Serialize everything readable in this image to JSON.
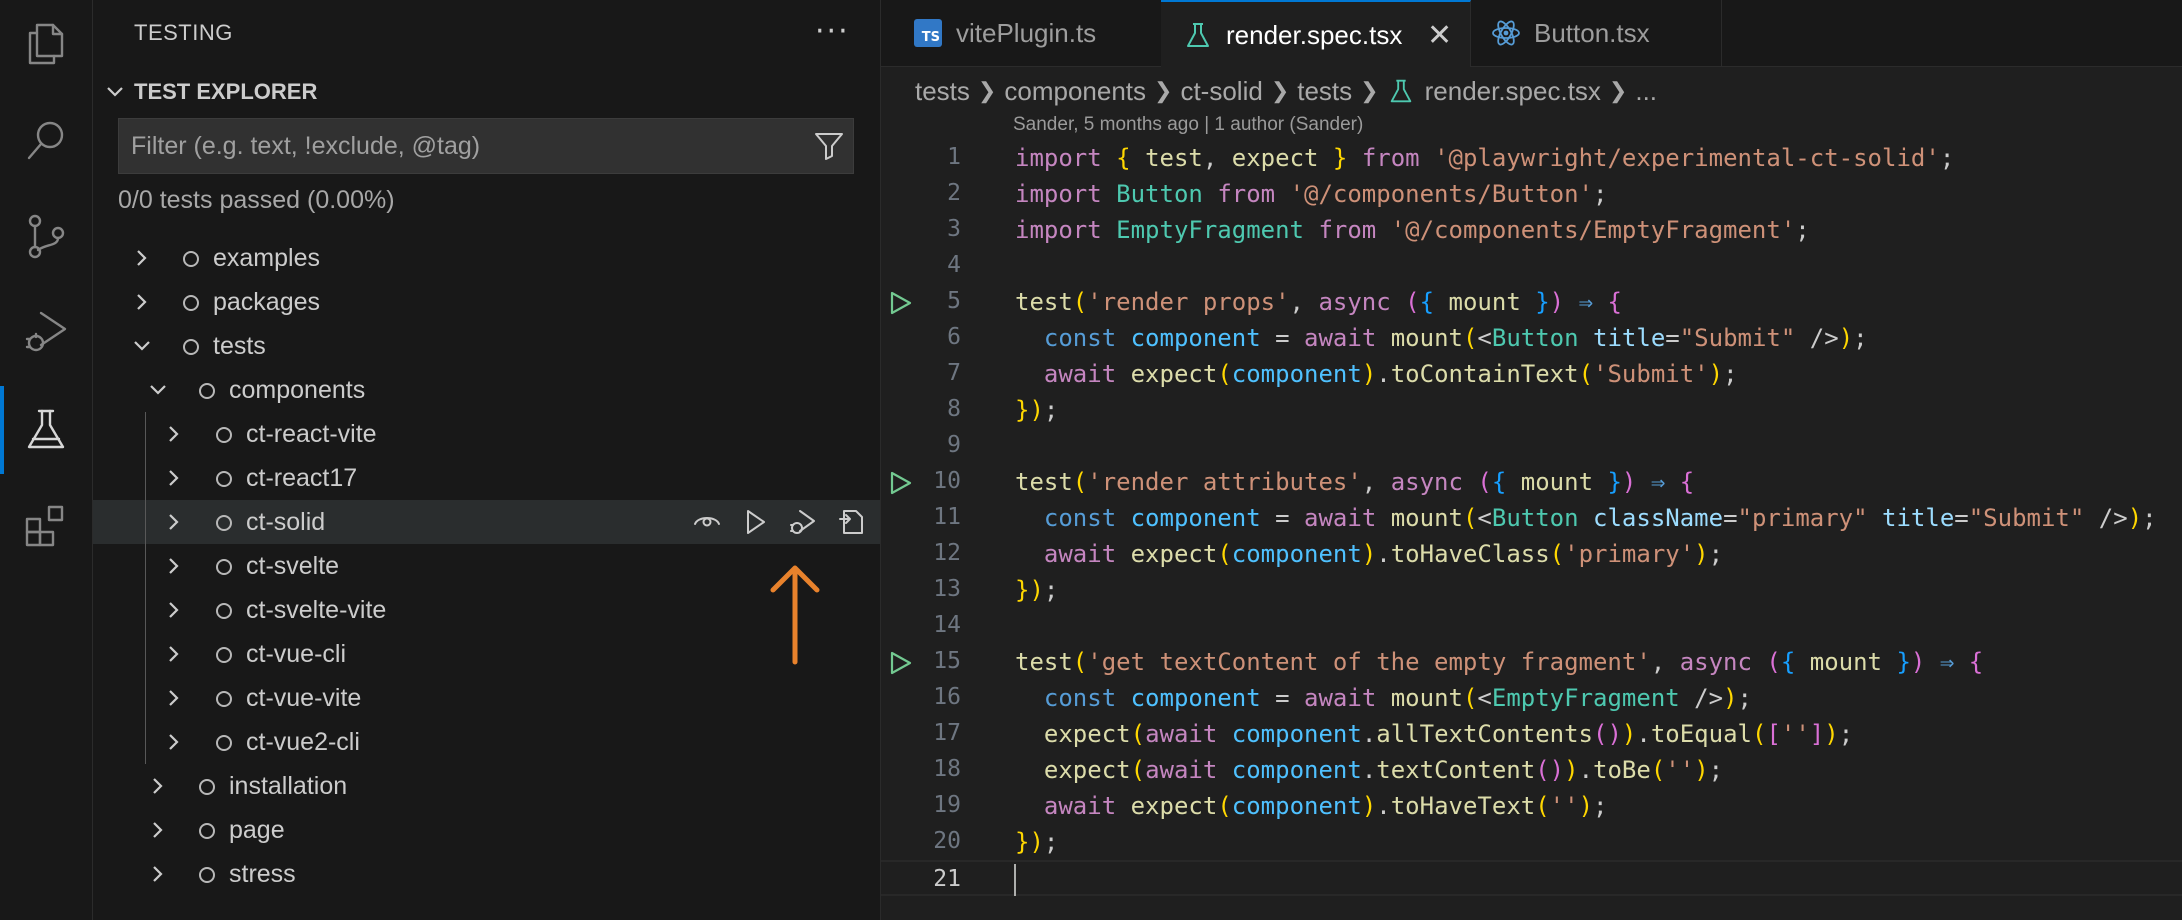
{
  "sidebar": {
    "title": "TESTING",
    "more": "···",
    "section_title": "TEST EXPLORER",
    "filter_placeholder": "Filter (e.g. text, !exclude, @tag)",
    "summary": "0/0 tests passed (0.00%)",
    "tree": [
      {
        "label": "examples",
        "expanded": false
      },
      {
        "label": "packages",
        "expanded": false
      },
      {
        "label": "tests",
        "expanded": true
      },
      {
        "label": "components",
        "expanded": true
      },
      {
        "label": "ct-react-vite",
        "expanded": false
      },
      {
        "label": "ct-react17",
        "expanded": false
      },
      {
        "label": "ct-solid",
        "expanded": false,
        "hovered": true
      },
      {
        "label": "ct-svelte",
        "expanded": false
      },
      {
        "label": "ct-svelte-vite",
        "expanded": false
      },
      {
        "label": "ct-vue-cli",
        "expanded": false
      },
      {
        "label": "ct-vue-vite",
        "expanded": false
      },
      {
        "label": "ct-vue2-cli",
        "expanded": false
      },
      {
        "label": "installation",
        "expanded": false
      },
      {
        "label": "page",
        "expanded": false
      },
      {
        "label": "stress",
        "expanded": false
      }
    ],
    "row_actions": [
      "eye-icon",
      "run-icon",
      "debug-icon",
      "go-to-file-icon"
    ]
  },
  "tabs": [
    {
      "label": "vitePlugin.ts",
      "icon": "typescript-icon",
      "badge": "TS",
      "active": false
    },
    {
      "label": "render.spec.tsx",
      "icon": "flask-icon",
      "active": true,
      "close": "✕"
    },
    {
      "label": "Button.tsx",
      "icon": "react-icon",
      "active": false
    }
  ],
  "breadcrumb": [
    "tests",
    "components",
    "ct-solid",
    "tests",
    "render.spec.tsx",
    "..."
  ],
  "codelens": "Sander, 5 months ago | 1 author (Sander)",
  "editor": {
    "current_line": 21,
    "line_numbers": [
      "1",
      "2",
      "3",
      "4",
      "5",
      "6",
      "7",
      "8",
      "9",
      "10",
      "11",
      "12",
      "13",
      "14",
      "15",
      "16",
      "17",
      "18",
      "19",
      "20",
      "21"
    ],
    "lines": [
      "import { test, expect } from '@playwright/experimental-ct-solid';",
      "import Button from '@/components/Button';",
      "import EmptyFragment from '@/components/EmptyFragment';",
      "",
      "test('render props', async ({ mount }) => {",
      "  const component = await mount(<Button title=\"Submit\" />);",
      "  await expect(component).toContainText('Submit');",
      "});",
      "",
      "test('render attributes', async ({ mount }) => {",
      "  const component = await mount(<Button className=\"primary\" title=\"Submit\" />);",
      "  await expect(component).toHaveClass('primary');",
      "});",
      "",
      "test('get textContent of the empty fragment', async ({ mount }) => {",
      "  const component = await mount(<EmptyFragment />);",
      "  expect(await component.allTextContents()).toEqual(['']);",
      "  expect(await component.textContent()).toBe('');",
      "  await expect(component).toHaveText('');",
      "});",
      ""
    ],
    "run_glyph_lines": [
      5,
      10,
      15
    ]
  },
  "colors": {
    "accent": "#0078d4",
    "annotation_arrow": "#e8822c",
    "run_glyph": "#73c991"
  }
}
